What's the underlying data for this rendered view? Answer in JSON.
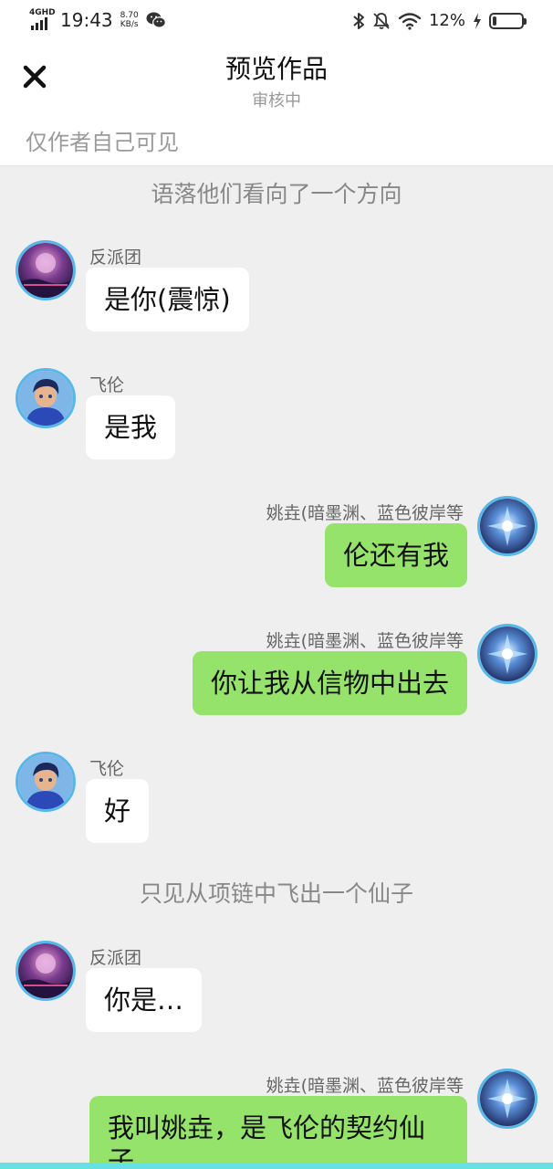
{
  "status_bar": {
    "network": "4GHD",
    "time": "19:43",
    "speed_value": "8.70",
    "speed_unit": "KB/s",
    "battery_percent": "12%",
    "battery_level": 0.12,
    "icons": [
      "signal-icon",
      "wechat-icon",
      "bluetooth-icon",
      "mute-bell-icon",
      "wifi-icon",
      "charging-icon",
      "battery-icon"
    ]
  },
  "header": {
    "close_icon": "close-icon",
    "title": "预览作品",
    "subtitle": "审核中",
    "visibility_note": "仅作者自己可见"
  },
  "chat": {
    "items": [
      {
        "kind": "narration",
        "text": "语落他们看向了一个方向"
      },
      {
        "kind": "message",
        "side": "left",
        "sender": "反派团",
        "text": "是你(震惊)",
        "avatar": "villain-group-avatar"
      },
      {
        "kind": "message",
        "side": "left",
        "sender": "飞伦",
        "text": "是我",
        "avatar": "feilun-avatar"
      },
      {
        "kind": "message",
        "side": "right",
        "sender": "姚垚(暗墨渊、蓝色彼岸等",
        "text": "伦还有我",
        "avatar": "yaoyao-avatar"
      },
      {
        "kind": "message",
        "side": "right",
        "sender": "姚垚(暗墨渊、蓝色彼岸等",
        "text": "你让我从信物中出去",
        "avatar": "yaoyao-avatar"
      },
      {
        "kind": "message",
        "side": "left",
        "sender": "飞伦",
        "text": "好",
        "avatar": "feilun-avatar"
      },
      {
        "kind": "narration",
        "text": "只见从项链中飞出一个仙子"
      },
      {
        "kind": "message",
        "side": "left",
        "sender": "反派团",
        "text": "你是…",
        "avatar": "villain-group-avatar"
      },
      {
        "kind": "message",
        "side": "right",
        "sender": "姚垚(暗墨渊、蓝色彼岸等",
        "text": "我叫姚垚，是飞伦的契约仙子",
        "avatar": "yaoyao-avatar"
      }
    ]
  },
  "colors": {
    "background": "#efefef",
    "bubble_left": "#ffffff",
    "bubble_right": "#95e36b",
    "avatar_ring": "#58b7ea",
    "bottom_strip": "#67e0e4"
  }
}
